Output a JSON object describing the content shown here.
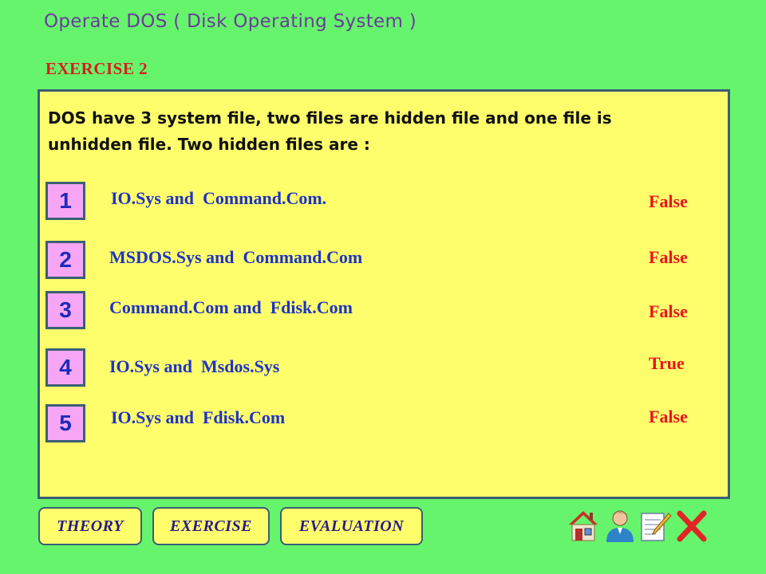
{
  "header": {
    "title": "Operate DOS ( Disk Operating System )",
    "exercise_label": "EXERCISE  2"
  },
  "question": {
    "text": "DOS have 3 system file, two files are hidden file and one file is unhidden file. Two hidden files are :",
    "options": [
      {
        "number": "1",
        "text": "IO.Sys and  Command.Com.",
        "verdict": "False"
      },
      {
        "number": "2",
        "text": "MSDOS.Sys and  Command.Com",
        "verdict": "False"
      },
      {
        "number": "3",
        "text": "Command.Com and  Fdisk.Com",
        "verdict": "False"
      },
      {
        "number": "4",
        "text": "IO.Sys and  Msdos.Sys",
        "verdict": "True"
      },
      {
        "number": "5",
        "text": "IO.Sys and  Fdisk.Com",
        "verdict": "False"
      }
    ]
  },
  "nav": {
    "theory_label": "THEORY",
    "exercise_label": "EXERCISE",
    "evaluation_label": "EVALUATION"
  },
  "icons": [
    "home-icon",
    "user-icon",
    "notepad-pencil-icon",
    "close-icon"
  ],
  "colors": {
    "background": "#66f46c",
    "panel": "#fefe6c",
    "number_box": "#f6a6f5",
    "option_text": "#1f33c4",
    "verdict_text": "#e8161f",
    "title_text": "#6a3d9a"
  }
}
